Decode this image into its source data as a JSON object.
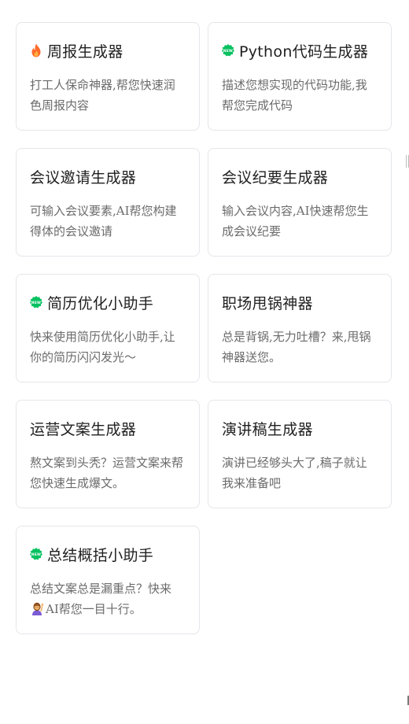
{
  "cards": [
    {
      "icon": "fire-icon",
      "title": "周报生成器",
      "desc": "打工人保命神器,帮您快速润色周报内容"
    },
    {
      "icon": "new-badge-icon",
      "title": "Python代码生成器",
      "desc": "描述您想实现的代码功能,我帮您完成代码"
    },
    {
      "icon": "",
      "title": "会议邀请生成器",
      "desc": "可输入会议要素,AI帮您构建得体的会议邀请"
    },
    {
      "icon": "",
      "title": "会议纪要生成器",
      "desc": "输入会议内容,AI快速帮您生成会议纪要"
    },
    {
      "icon": "new-badge-icon",
      "title": "简历优化小助手",
      "desc": "快来使用简历优化小助手,让你的简历闪闪发光～"
    },
    {
      "icon": "",
      "title": "职场甩锅神器",
      "desc": "总是背锅,无力吐槽？来,甩锅神器送您。"
    },
    {
      "icon": "",
      "title": "运营文案生成器",
      "desc": "熬文案到头秃？运营文案来帮您快速生成爆文。"
    },
    {
      "icon": "",
      "title": "演讲稿生成器",
      "desc": "演讲已经够头大了,稿子就让我来准备吧"
    },
    {
      "icon": "new-badge-icon",
      "title": "总结概括小助手",
      "desc_pre": "总结文案总是漏重点？快来",
      "desc_emoji": "person-raising-hand-icon",
      "desc_post": "AI帮您一目十行。"
    }
  ],
  "colors": {
    "new_badge": "#07c160",
    "fire": "#ff6a2b",
    "title": "#1f1f1f",
    "desc": "#6b6b6b",
    "border": "#e4e6ea"
  }
}
